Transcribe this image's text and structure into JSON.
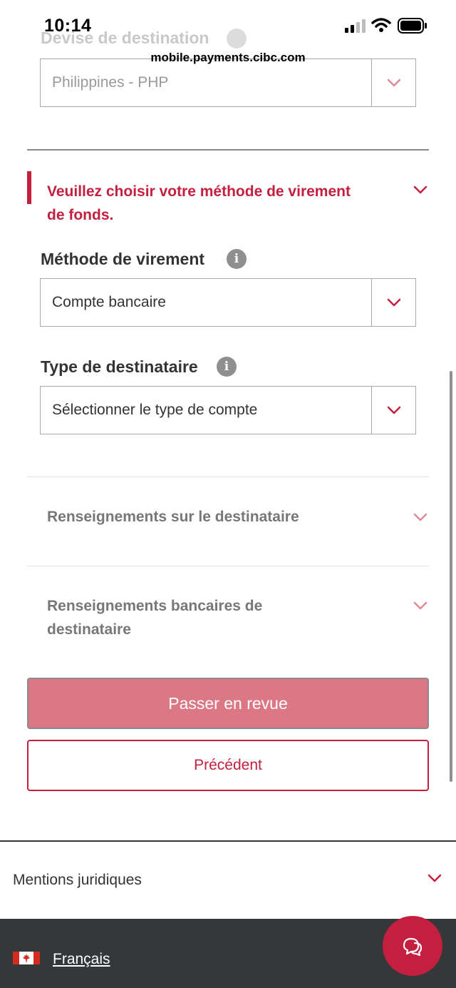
{
  "status_bar": {
    "time": "10:14",
    "url": "mobile.payments.cibc.com"
  },
  "destination_currency": {
    "label": "Devise de destination",
    "value": "Philippines - PHP"
  },
  "alert": {
    "text": "Veuillez choisir votre méthode de virement de fonds."
  },
  "transfer_method": {
    "label": "Méthode de virement",
    "value": "Compte bancaire"
  },
  "recipient_type": {
    "label": "Type de destinataire",
    "value": "Sélectionner le type de compte"
  },
  "sections": {
    "recipient_info": "Renseignements sur le destinataire",
    "recipient_bank_info": "Renseignements bancaires de destinataire"
  },
  "buttons": {
    "review": "Passer en revue",
    "previous": "Précédent"
  },
  "footer": {
    "legal": "Mentions juridiques",
    "language": "Français"
  },
  "icons": {
    "info_glyph": "i"
  },
  "colors": {
    "brand_red": "#c41f3e",
    "disabled_primary": "#dc7886",
    "footer_bg": "#34383b"
  }
}
